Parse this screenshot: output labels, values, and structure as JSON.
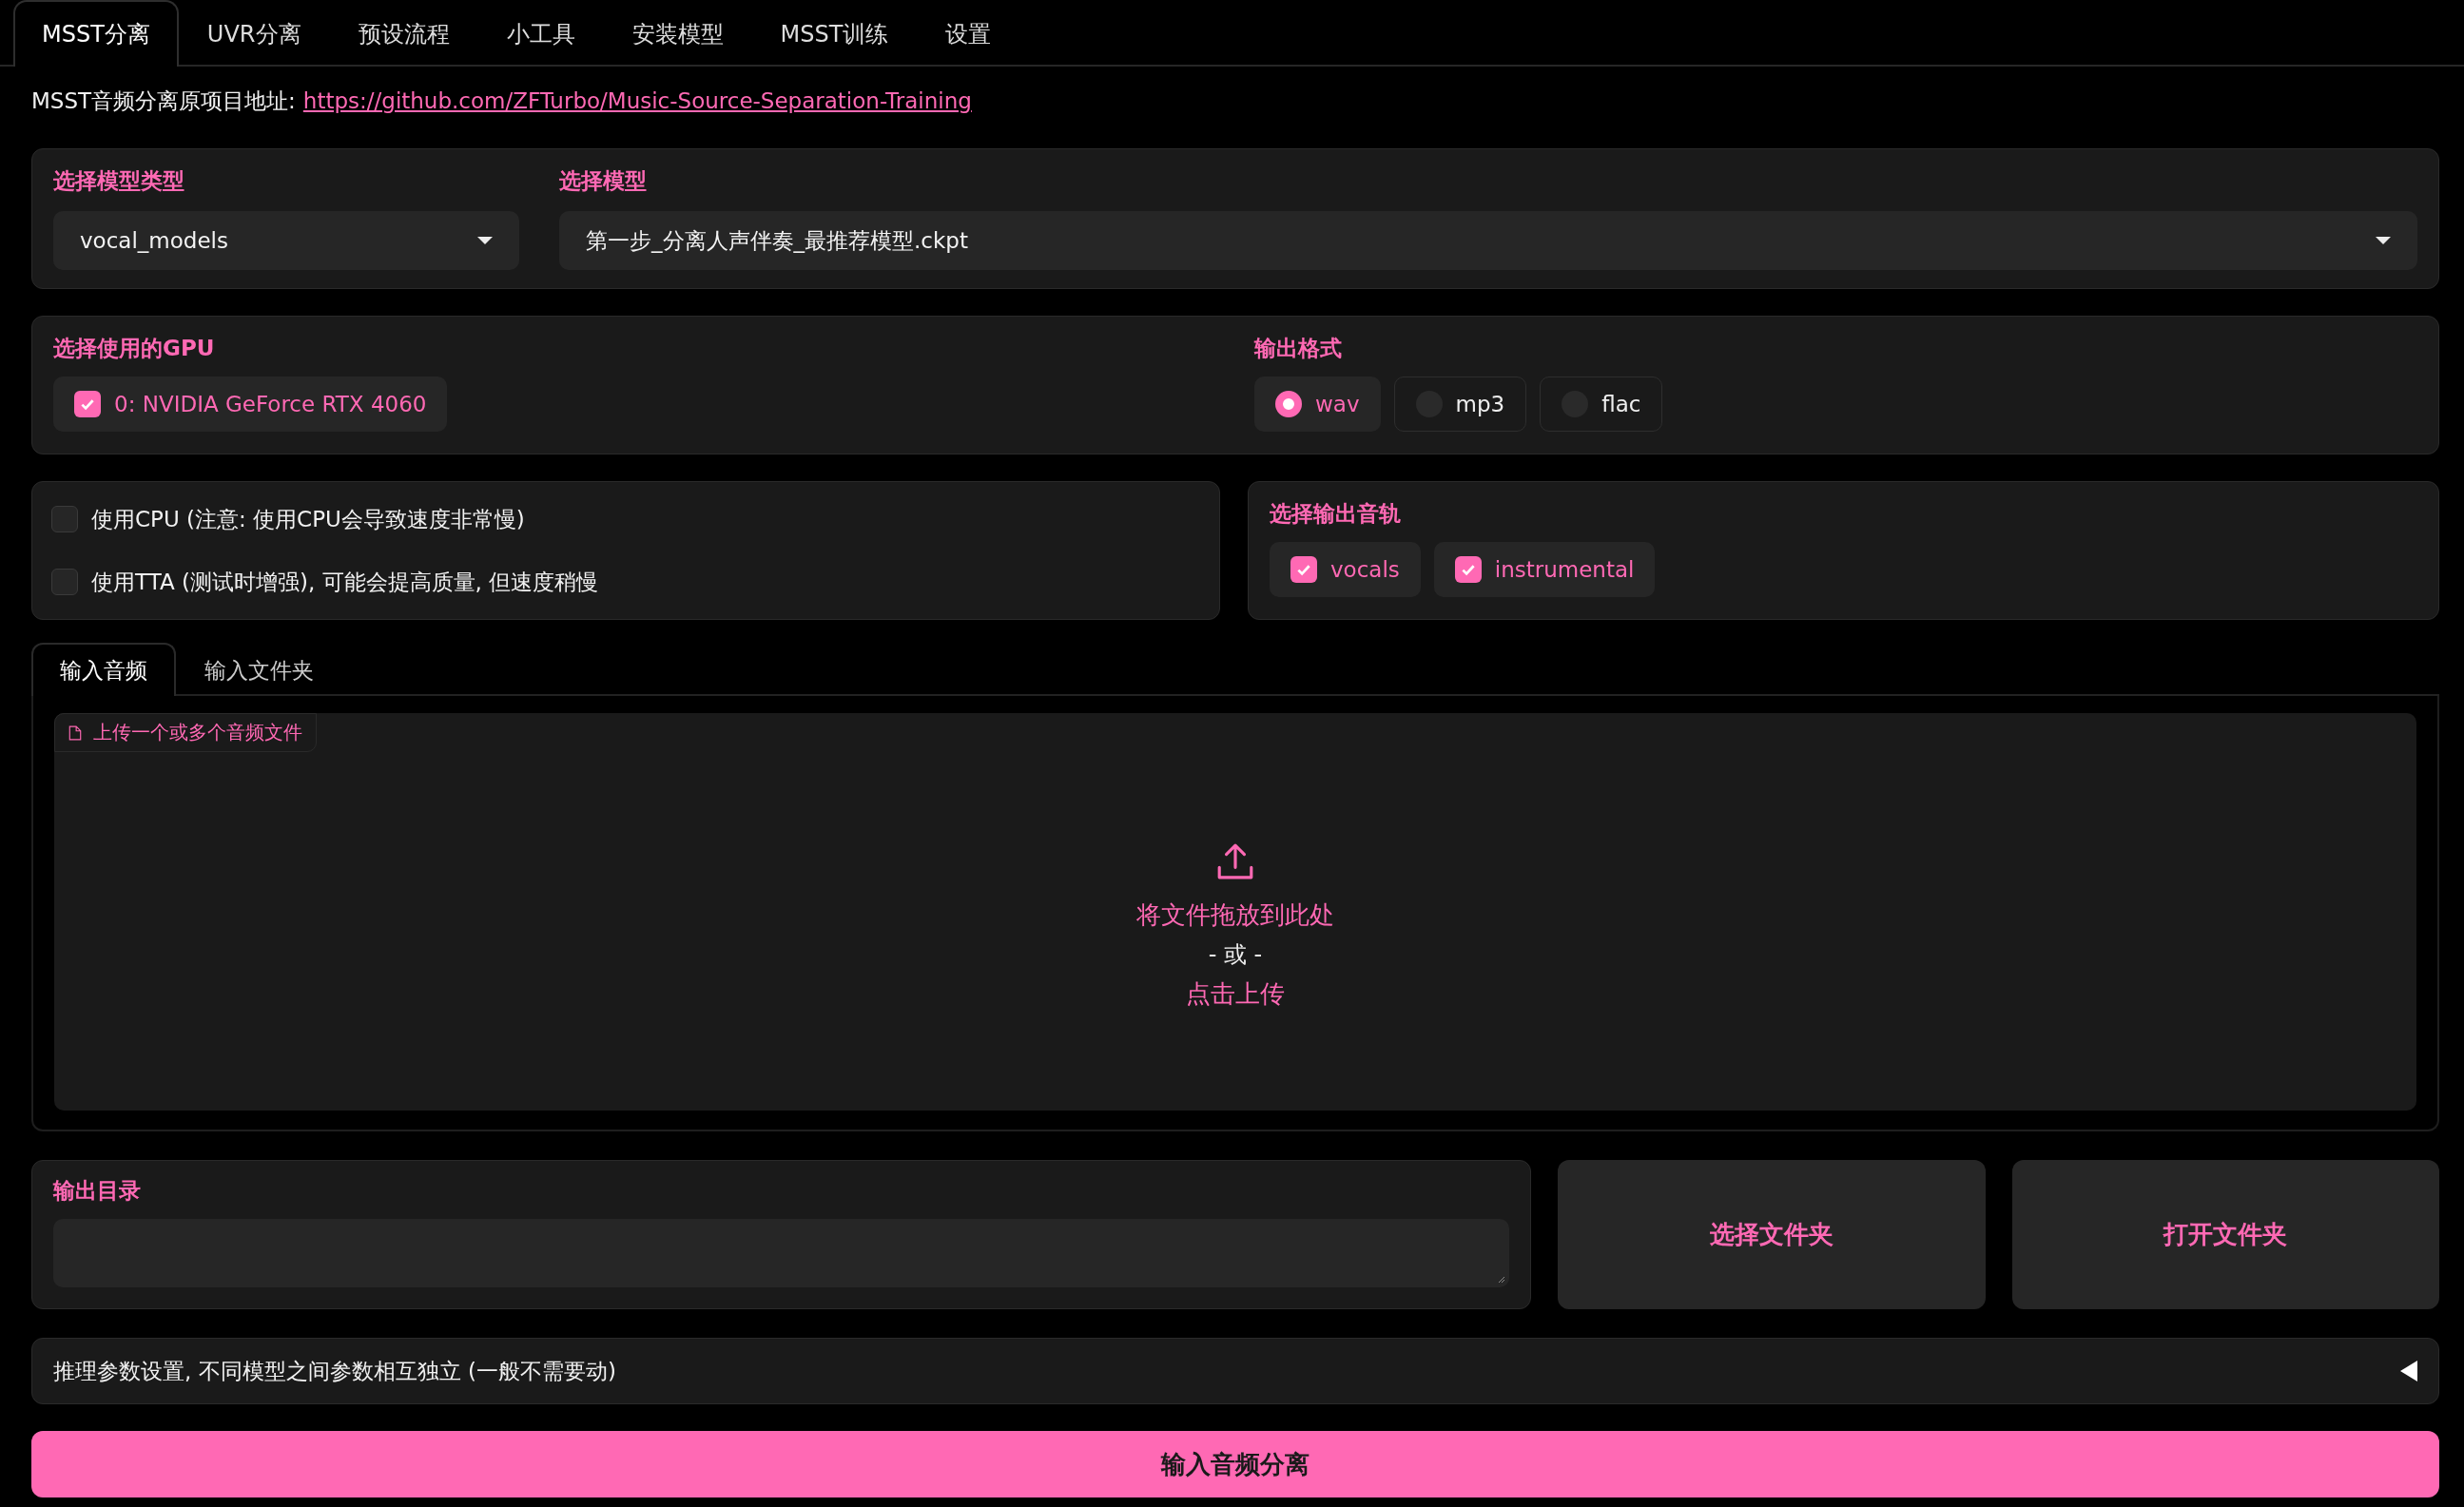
{
  "tabs": [
    {
      "label": "MSST分离",
      "selected": true
    },
    {
      "label": "UVR分离",
      "selected": false
    },
    {
      "label": "预设流程",
      "selected": false
    },
    {
      "label": "小工具",
      "selected": false
    },
    {
      "label": "安装模型",
      "selected": false
    },
    {
      "label": "MSST训练",
      "selected": false
    },
    {
      "label": "设置",
      "selected": false
    }
  ],
  "intro": {
    "text": "MSST音频分离原项目地址:",
    "link": "https://github.com/ZFTurbo/Music-Source-Separation-Training"
  },
  "model_type": {
    "label": "选择模型类型",
    "value": "vocal_models"
  },
  "model": {
    "label": "选择模型",
    "value": "第一步_分离人声伴奏_最推荐模型.ckpt"
  },
  "gpu": {
    "label": "选择使用的GPU",
    "options": [
      {
        "label": "0: NVIDIA GeForce RTX 4060",
        "checked": true
      }
    ]
  },
  "output_format": {
    "label": "输出格式",
    "options": [
      {
        "label": "wav",
        "selected": true
      },
      {
        "label": "mp3",
        "selected": false
      },
      {
        "label": "flac",
        "selected": false
      }
    ]
  },
  "settings": [
    {
      "label": "使用CPU (注意: 使用CPU会导致速度非常慢)",
      "checked": false
    },
    {
      "label": "使用TTA (测试时增强), 可能会提高质量, 但速度稍慢",
      "checked": false
    }
  ],
  "output_stems": {
    "label": "选择输出音轨",
    "options": [
      {
        "label": "vocals",
        "checked": true
      },
      {
        "label": "instrumental",
        "checked": true
      }
    ]
  },
  "input_tabs": [
    {
      "label": "输入音频",
      "selected": true
    },
    {
      "label": "输入文件夹",
      "selected": false
    }
  ],
  "upload": {
    "label": "上传一个或多个音频文件",
    "drop_text": "将文件拖放到此处",
    "or_text": "- 或 -",
    "click_text": "点击上传"
  },
  "output_dir": {
    "label": "输出目录"
  },
  "buttons": [
    {
      "label": "选择文件夹"
    },
    {
      "label": "打开文件夹"
    }
  ],
  "accordion": {
    "label": "推理参数设置, 不同模型之间参数相互独立 (一般不需要动)",
    "expanded": false
  },
  "submit": {
    "label": "输入音频分离"
  }
}
